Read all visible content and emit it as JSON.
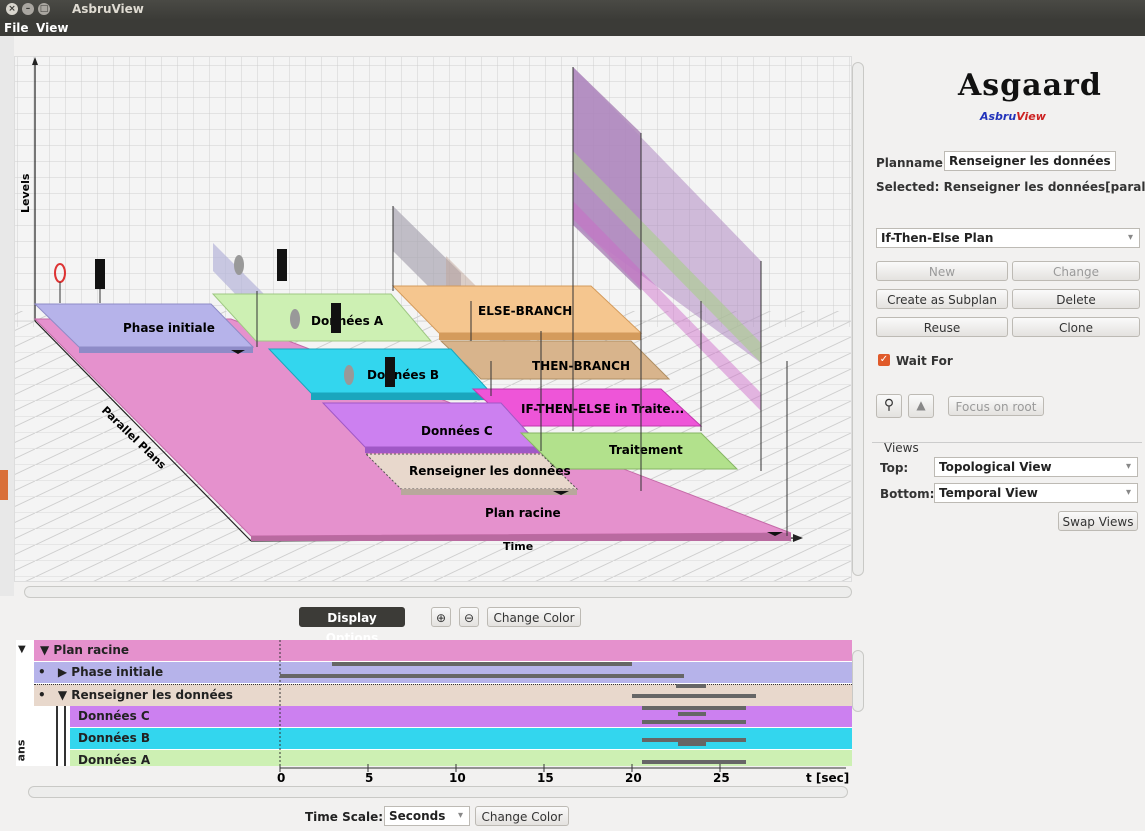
{
  "window": {
    "title": "AsbruView"
  },
  "menu": {
    "file": "File",
    "view": "View"
  },
  "top_view": {
    "axis_levels": "Levels",
    "axis_time": "Time",
    "axis_parallel": "Parallel Plans",
    "plans": {
      "phase_initiale": "Phase initiale",
      "donnees_a": "Données A",
      "donnees_b": "Données B",
      "donnees_c": "Données C",
      "renseigner": "Renseigner les données",
      "plan_racine": "Plan racine",
      "else_branch": "ELSE-BRANCH",
      "then_branch": "THEN-BRANCH",
      "if_then_else": "IF-THEN-ELSE in Traite...",
      "traitement": "Traitement"
    }
  },
  "display_toolbar": {
    "display_options": "Display Options",
    "zoom_in": "zoom-in",
    "zoom_out": "zoom-out",
    "change_color": "Change Color"
  },
  "timeline": {
    "rows": [
      {
        "label": "Plan racine",
        "expanded": true
      },
      {
        "label": "Phase initiale",
        "expanded": false
      },
      {
        "label": "Renseigner les données",
        "expanded": true
      },
      {
        "label": "Données C"
      },
      {
        "label": "Données B"
      },
      {
        "label": "Données A"
      }
    ],
    "side_label": "ans",
    "ticks": [
      "0",
      "5",
      "10",
      "15",
      "20",
      "25"
    ],
    "unit": "t [sec]"
  },
  "bottom_bar": {
    "time_scale_label": "Time Scale:",
    "time_scale_value": "Seconds",
    "change_color": "Change Color"
  },
  "side_panel": {
    "logo": "Asgaard",
    "logo_sub_a": "Asbru",
    "logo_sub_b": "View",
    "planname_label": "Planname:",
    "planname_value": "Renseigner les données",
    "selected_text": "Selected: Renseigner les données[parallel]",
    "plan_type": "If-Then-Else Plan",
    "buttons": {
      "new": "New",
      "change": "Change",
      "create_subplan": "Create as Subplan",
      "delete": "Delete",
      "reuse": "Reuse",
      "clone": "Clone"
    },
    "wait_for": "Wait For",
    "focus_root": "Focus on root",
    "views_title": "Views",
    "top_label": "Top:",
    "top_value": "Topological View",
    "bottom_label": "Bottom:",
    "bottom_value": "Temporal View",
    "swap_views": "Swap Views"
  },
  "colors": {
    "plan_racine": "#e591cd",
    "phase_initiale": "#b6b3ea",
    "donnees_a": "#cdf0b3",
    "donnees_b": "#33d6ee",
    "donnees_c": "#cc80f0",
    "renseigner": "#e8d8cc",
    "else_branch": "#f5c68f",
    "then_branch": "#d8b48c",
    "if_then_else": "#ee55d8",
    "traitement": "#b2e18c",
    "accent": "#e05a2a"
  }
}
